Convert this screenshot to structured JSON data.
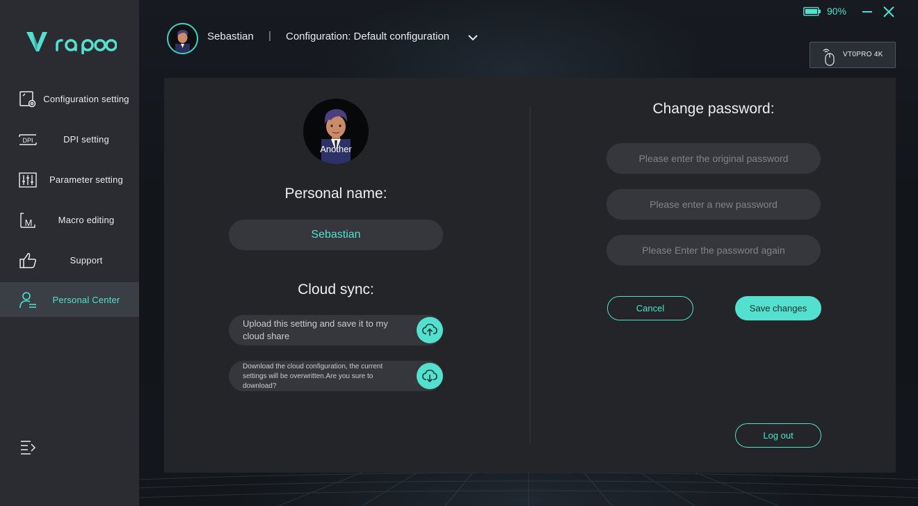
{
  "brand": {
    "name": "rapoo",
    "accent": "#53e0cf"
  },
  "window": {
    "battery_percent": "90%",
    "minimize_icon": "minimize-icon",
    "close_icon": "close-icon"
  },
  "header": {
    "user_name": "Sebastian",
    "separator": "|",
    "config_label": "Configuration: Default configuration",
    "device_label": "VT0PRO 4K"
  },
  "sidebar": {
    "items": [
      {
        "label": "Configuration setting",
        "icon": "config-gear-icon",
        "active": false
      },
      {
        "label": "DPI setting",
        "icon": "dpi-icon",
        "active": false
      },
      {
        "label": "Parameter setting",
        "icon": "sliders-icon",
        "active": false
      },
      {
        "label": "Macro editing",
        "icon": "macro-icon",
        "active": false
      },
      {
        "label": "Support",
        "icon": "thumbs-up-icon",
        "active": false
      },
      {
        "label": "Personal Center",
        "icon": "user-card-icon",
        "active": true
      }
    ],
    "collapse_icon": "menu-collapse-icon"
  },
  "profile": {
    "avatar_caption": "Another",
    "personal_name_title": "Personal name:",
    "personal_name_value": "Sebastian",
    "cloud_sync_title": "Cloud sync:",
    "upload_text": "Upload this setting and save it to my cloud share",
    "download_text": "Download the cloud configuration, the current settings will be overwritten.Are you sure to download?"
  },
  "password": {
    "title": "Change password:",
    "original_placeholder": "Please enter the original password",
    "new_placeholder": "Please enter a new password",
    "again_placeholder": "Please Enter the password again",
    "cancel_label": "Cancel",
    "save_label": "Save changes",
    "logout_label": "Log out"
  }
}
